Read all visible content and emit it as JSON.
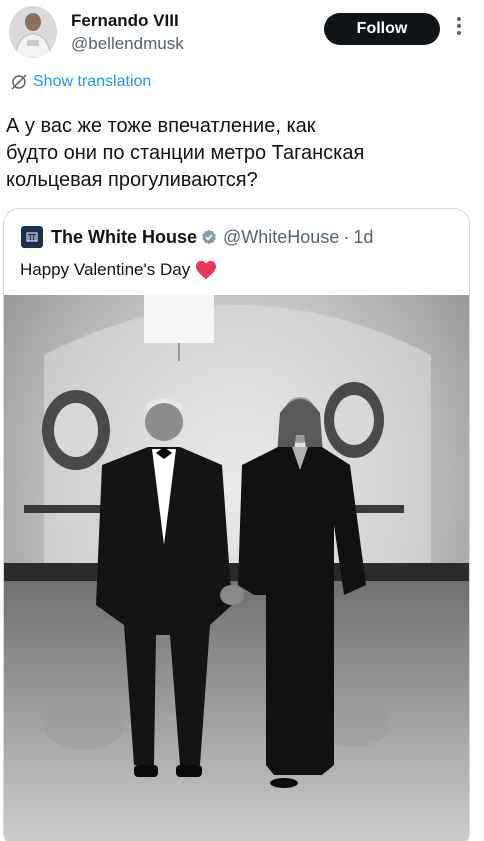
{
  "author": {
    "display_name": "Fernando VIII",
    "handle": "@bellendmusk",
    "avatar_icon": "avatar-photo",
    "follow_label": "Follow",
    "more_icon": "more-vertical-icon"
  },
  "translation": {
    "label": "Show translation",
    "icon": "translate-icon"
  },
  "tweet": {
    "lines": [
      "А у вас же тоже впечатление, как",
      "будто они по станции метро Таганская",
      "кольцевая прогуливаются?"
    ]
  },
  "quoted_post": {
    "display_name": "The White House",
    "verified_icon": "verified-badge-icon",
    "handle": "@WhiteHouse",
    "separator": "·",
    "time": "1d",
    "text": "Happy Valentine's Day",
    "emoji": "heart-icon",
    "media": "grayscale-photo-couple-in-hallway"
  },
  "colors": {
    "text": "#0f1419",
    "secondary": "#536471",
    "link": "#1d9bf0",
    "button_bg": "#0f1419",
    "border": "#cfd9de",
    "heart": "#f91880",
    "verified": "#829aab"
  }
}
